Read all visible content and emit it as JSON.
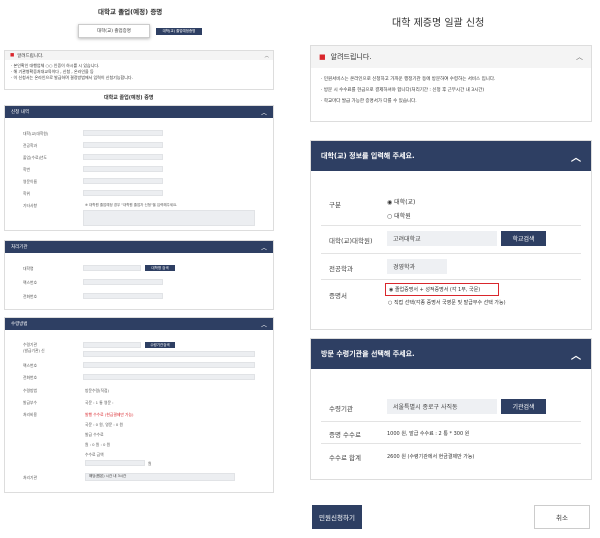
{
  "left": {
    "title": "대학교 졸업(예정) 증명",
    "tabs": [
      "대학(교) 졸업증명",
      "대학(교) 졸업예정증명"
    ],
    "notice": {
      "title": "알려드립니다.",
      "lines": [
        "· 본인확인 대행업체 ○○ 인증이 하시를 시 있습니다.",
        "· 해 기관병확증처대교육이다 , 신청 , 온라인을 등",
        "· 이 신청서는 온라인으로 발급하며 결정방법에서 입력이 신청기능합니다."
      ]
    },
    "subtitle": "대학교 졸업(예정) 증명",
    "s1": {
      "header": "신청 내역",
      "rows": [
        "대학(교)대학원)",
        "전공학과",
        "졸업(수료)년도",
        "학번",
        "영문이름",
        "학위",
        "기타사항"
      ],
      "note": "※ 대학원 졸업예정 경우 \"대학원 졸업자 신청\"을 입력해주세요."
    },
    "s2": {
      "header": "처리기관",
      "rows": [
        "대학명",
        "팩스번호",
        "전화번호"
      ],
      "btn": "대학명 검색"
    },
    "s3": {
      "header": "수령방법",
      "rows": [
        "수령기관",
        "(발급기관) 신",
        "팩스번호",
        "전화번호",
        "수령방법",
        "발급부수",
        "처리비용",
        "",
        "",
        "",
        "처리기관"
      ],
      "btn": "수령기관검색",
      "radio": "방문수령(직접)",
      "copies": "국문 :  1   통    영문 :",
      "fee_title": "발행 수수료 (현금결제만 가능)",
      "fee_lines": [
        "국문 :  0  원,    영문 :  0  원",
        "발급 수수료",
        "원 :  0    원 :  0  원",
        "수수료 금액"
      ],
      "won": "원",
      "agency": "해당(원본) 시간 내 3시간"
    }
  },
  "right": {
    "title": "대학 제증명 일괄 신청",
    "notice_title": "알려드립니다.",
    "notice_lines": [
      "· 민원서비스는 온라인으로 신청하고 가까운 행정기관 등에 방문하여 수령하는 서비스 입니다.",
      "· 방문 시 수수료를 현금으로 결제하셔야 합니다(처리기간 : 신청 후 근무시간 내 3시간)",
      "· 학교마다 발급 가능한 증명서가 다를 수 있습니다."
    ],
    "s1": {
      "header": "대학(교) 정보를 입력해 주세요.",
      "type_label": "구분",
      "type_opts": [
        "대학(교)",
        "대학원"
      ],
      "univ_label": "대학(교)대학원)",
      "univ_value": "고려대학교",
      "univ_btn": "학교검색",
      "major_label": "전공학과",
      "major_value": "경영학과",
      "cert_label": "증명서",
      "cert_opt1": "졸업증명서 + 성적증명서 (각 1부, 국문)",
      "cert_opt2": "직접 선택(각종 증명서 국영문 및 발급부수 선택 가능)"
    },
    "s2": {
      "header": "방문 수령기관을 선택해 주세요.",
      "agency_label": "수령기관",
      "agency_value": "서울특별시 종로구 사직동",
      "agency_btn": "기관검색",
      "fee_label": "증명 수수료",
      "fee_value": "1000 원, 발급 수수료 : 2 통 * 300 원",
      "total_label": "수수료 합계",
      "total_value": "2600 원 (수령기관에서 현금결제만 가능)"
    },
    "submit": "민원신청하기",
    "cancel": "취소"
  },
  "colors": {
    "navy": "#2e3f63",
    "highlight": "#d9262c"
  }
}
